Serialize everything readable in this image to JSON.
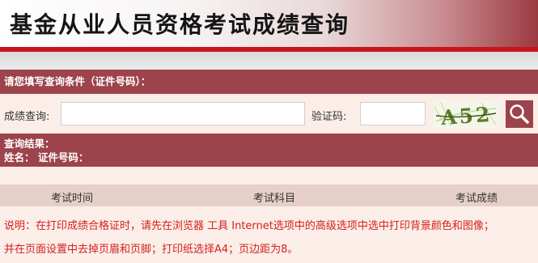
{
  "header": {
    "title": "基金从业人员资格考试成绩查询"
  },
  "query_section": {
    "heading": "请您填写查询条件（证件号码）："
  },
  "query_form": {
    "score_label": "成绩查询:",
    "score_value": "",
    "captcha_label": "验证码:",
    "captcha_value": "",
    "captcha_image_text": "A52"
  },
  "result_section": {
    "heading": "查询结果：",
    "name_line": "姓名：  证件号码："
  },
  "table": {
    "columns": [
      "考试时间",
      "考试科目",
      "考试成绩"
    ]
  },
  "notes": [
    "说明：在打印成绩合格证时，请先在浏览器 工具 Internet选项中的高级选项中选中打印背景颜色和图像；",
    "并在页面设置中去掉页眉和页脚；打印纸选择A4；页边距为8。"
  ],
  "colors": {
    "accent": "#9c434b",
    "header_red_line": "#c8141f",
    "notice_text": "#d6201e",
    "page_background": "#fbeee8"
  }
}
